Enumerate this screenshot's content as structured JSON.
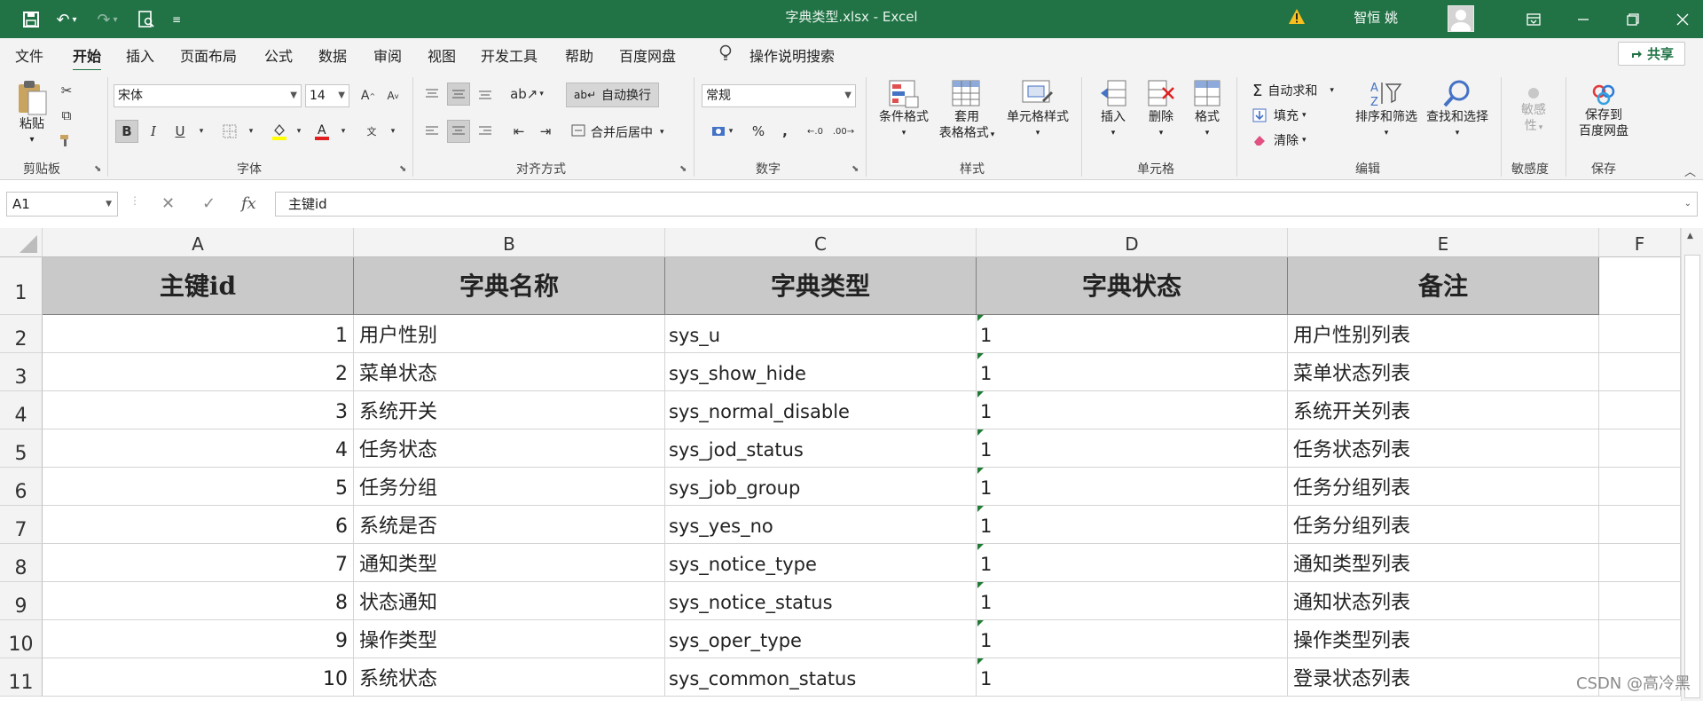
{
  "window": {
    "title": "字典类型.xlsx  -  Excel",
    "user": "智恒 姚"
  },
  "menu": {
    "tabs": [
      "文件",
      "开始",
      "插入",
      "页面布局",
      "公式",
      "数据",
      "审阅",
      "视图",
      "开发工具",
      "帮助",
      "百度网盘"
    ],
    "active_tab": "开始",
    "tell_me": "操作说明搜索",
    "share": "共享"
  },
  "ribbon": {
    "clipboard": {
      "paste": "粘贴",
      "label": "剪贴板"
    },
    "font": {
      "name": "宋体",
      "size": "14",
      "bold": "B",
      "italic": "I",
      "underline": "U",
      "label": "字体"
    },
    "alignment": {
      "wrap": "自动换行",
      "merge": "合并后居中",
      "label": "对齐方式"
    },
    "number": {
      "format": "常规",
      "label": "数字"
    },
    "styles": {
      "conditional": "条件格式",
      "table1": "套用",
      "table2": "表格格式",
      "cell_styles": "单元格样式",
      "label": "样式"
    },
    "cells": {
      "insert": "插入",
      "delete": "删除",
      "format": "格式",
      "label": "单元格"
    },
    "editing": {
      "autosum": "自动求和",
      "fill": "填充",
      "clear": "清除",
      "sort": "排序和筛选",
      "find": "查找和选择",
      "label": "编辑"
    },
    "sensitivity": {
      "btn1": "敏感",
      "btn2": "性",
      "label": "敏感度"
    },
    "save": {
      "btn1": "保存到",
      "btn2": "百度网盘",
      "label": "保存"
    }
  },
  "formula_bar": {
    "name_box": "A1",
    "content": "主键id"
  },
  "sheet": {
    "columns": [
      "A",
      "B",
      "C",
      "D",
      "E",
      "F"
    ],
    "row_numbers": [
      "1",
      "2",
      "3",
      "4",
      "5",
      "6",
      "7",
      "8",
      "9",
      "10",
      "11"
    ],
    "headers": [
      "主键id",
      "字典名称",
      "字典类型",
      "字典状态",
      "备注"
    ],
    "rows": [
      [
        "1",
        "用户性别",
        "sys_u",
        "1",
        "用户性别列表"
      ],
      [
        "2",
        "菜单状态",
        "sys_show_hide",
        "1",
        "菜单状态列表"
      ],
      [
        "3",
        "系统开关",
        "sys_normal_disable",
        "1",
        "系统开关列表"
      ],
      [
        "4",
        "任务状态",
        "sys_jod_status",
        "1",
        "任务状态列表"
      ],
      [
        "5",
        "任务分组",
        "sys_job_group",
        "1",
        "任务分组列表"
      ],
      [
        "6",
        "系统是否",
        "sys_yes_no",
        "1",
        "任务分组列表"
      ],
      [
        "7",
        "通知类型",
        "sys_notice_type",
        "1",
        "通知类型列表"
      ],
      [
        "8",
        "状态通知",
        "sys_notice_status",
        "1",
        "通知状态列表"
      ],
      [
        "9",
        "操作类型",
        "sys_oper_type",
        "1",
        "操作类型列表"
      ],
      [
        "10",
        "系统状态",
        "sys_common_status",
        "1",
        "登录状态列表"
      ]
    ]
  },
  "watermark": "CSDN @高冷黑",
  "colors": {
    "brand": "#217346",
    "header_fill": "#c9c9c9",
    "number_marker": "#1e7b34"
  }
}
